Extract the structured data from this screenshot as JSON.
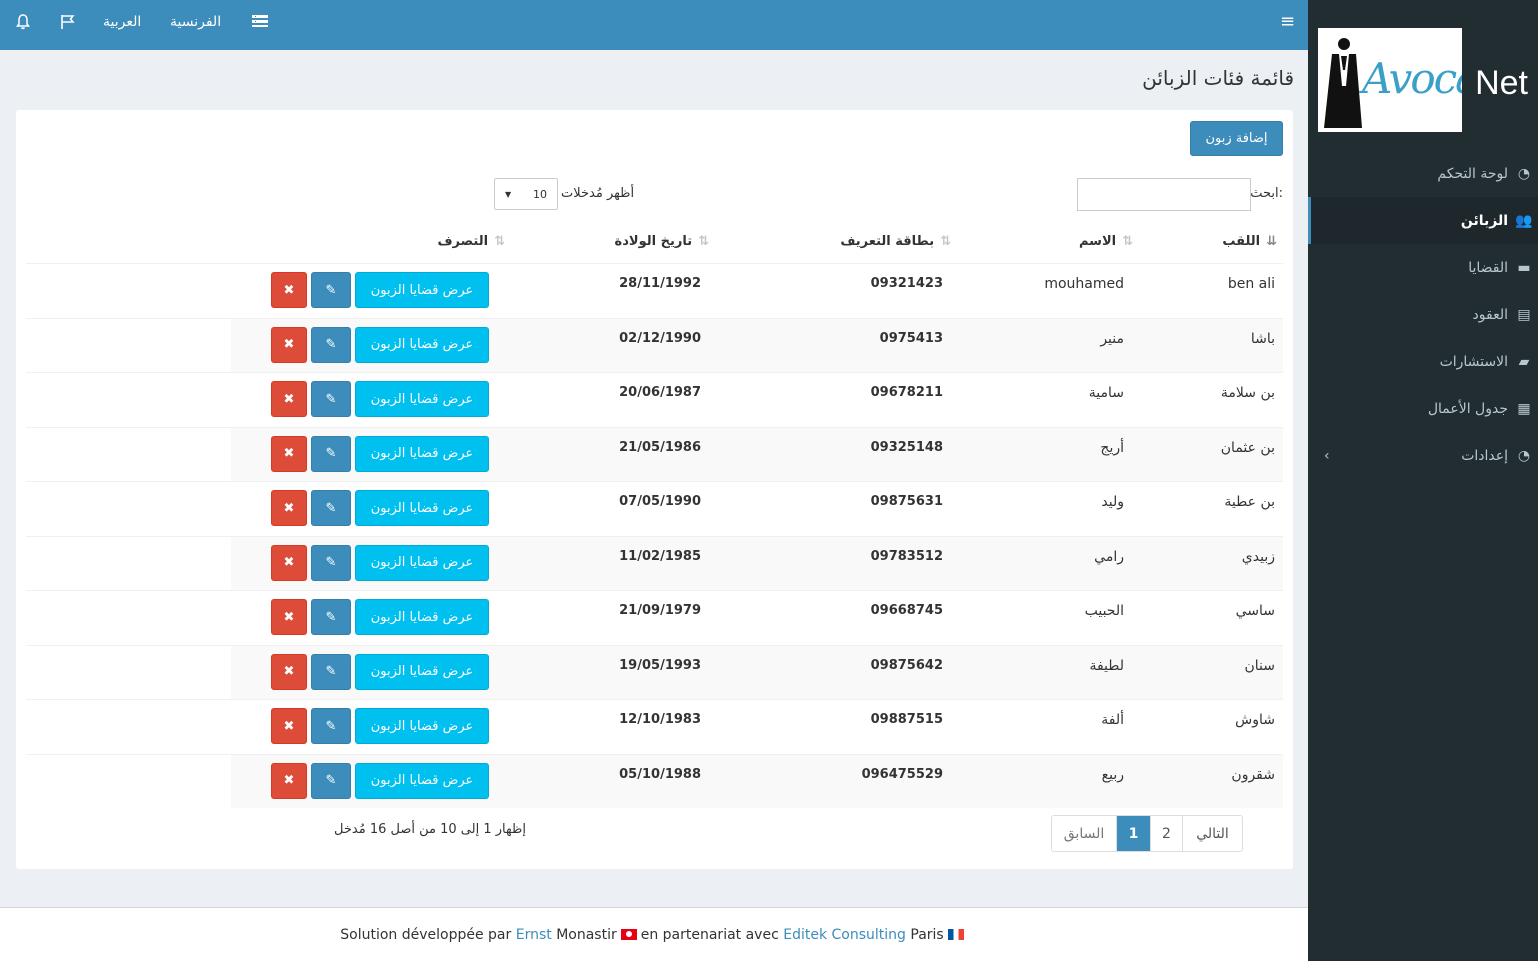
{
  "brand": {
    "logo_script": "Avoca",
    "name": "Net"
  },
  "sidebar": {
    "items": [
      {
        "label": "لوحة التحكم",
        "icon": "dashboard-icon",
        "glyph": "◔",
        "active": false
      },
      {
        "label": "الزبائن",
        "icon": "users-icon",
        "glyph": "👥",
        "active": true
      },
      {
        "label": "القضايا",
        "icon": "briefcase-icon",
        "glyph": "▬",
        "active": false
      },
      {
        "label": "العقود",
        "icon": "contract-icon",
        "glyph": "▤",
        "active": false
      },
      {
        "label": "الاستشارات",
        "icon": "book-icon",
        "glyph": "▰",
        "active": false
      },
      {
        "label": "جدول الأعمال",
        "icon": "calendar-icon",
        "glyph": "▦",
        "active": false
      },
      {
        "label": "إعدادات",
        "icon": "settings-icon",
        "glyph": "◔",
        "active": false
      }
    ],
    "chevron": "‹"
  },
  "topbar": {
    "menu_toggle": "≡",
    "lang_ar": "العربية",
    "lang_fr": "الفرنسية",
    "list_icon": "☰",
    "flag_icon": "⚐",
    "bell_icon": "🔔"
  },
  "page": {
    "title": "قائمة فئات الزبائن",
    "add_button": "إضافة زبون",
    "search_label": "ابحث:",
    "length_label": "أظهر مُدخلات",
    "length_value": "10",
    "length_arrow": "▼"
  },
  "table": {
    "headers": {
      "lname": "اللقب",
      "fname": "الاسم",
      "id": "بطاقة التعريف",
      "dob": "تاريخ الولادة",
      "actions": "التصرف"
    },
    "sort_icon": "⇅",
    "sort_active_icon": "⇊",
    "view_label": "عرض قضايا الزبون",
    "edit_glyph": "✎",
    "delete_glyph": "✖",
    "rows": [
      {
        "lname": "ben ali",
        "fname": "mouhamed",
        "id": "09321423",
        "dob": "28/11/1992"
      },
      {
        "lname": "باشا",
        "fname": "منير",
        "id": "0975413",
        "dob": "02/12/1990"
      },
      {
        "lname": "بن سلامة",
        "fname": "سامية",
        "id": "09678211",
        "dob": "20/06/1987"
      },
      {
        "lname": "بن عثمان",
        "fname": "أريج",
        "id": "09325148",
        "dob": "21/05/1986"
      },
      {
        "lname": "بن عطية",
        "fname": "وليد",
        "id": "09875631",
        "dob": "07/05/1990"
      },
      {
        "lname": "زبيدي",
        "fname": "رامي",
        "id": "09783512",
        "dob": "11/02/1985"
      },
      {
        "lname": "ساسي",
        "fname": "الحبيب",
        "id": "09668745",
        "dob": "21/09/1979"
      },
      {
        "lname": "سنان",
        "fname": "لطيفة",
        "id": "09875642",
        "dob": "19/05/1993"
      },
      {
        "lname": "شاوش",
        "fname": "ألفة",
        "id": "09887515",
        "dob": "12/10/1983"
      },
      {
        "lname": "شقرون",
        "fname": "ربيع",
        "id": "096475529",
        "dob": "05/10/1988"
      }
    ]
  },
  "info_text": "إظهار 1 إلى 10 من أصل 16 مُدخل",
  "pagination": {
    "prev": "السابق",
    "page1": "1",
    "page2": "2",
    "next": "التالي"
  },
  "footer": {
    "t1": "Solution développée par",
    "link1": "Ernst",
    "t2": "Monastir",
    "t3": "en partenariat avec",
    "link2": "Editek Consulting",
    "t4": "Paris"
  },
  "colors": {
    "primary": "#3c8dbc",
    "info": "#00c0ef",
    "danger": "#dd4b39",
    "sidebar": "#222d32"
  }
}
